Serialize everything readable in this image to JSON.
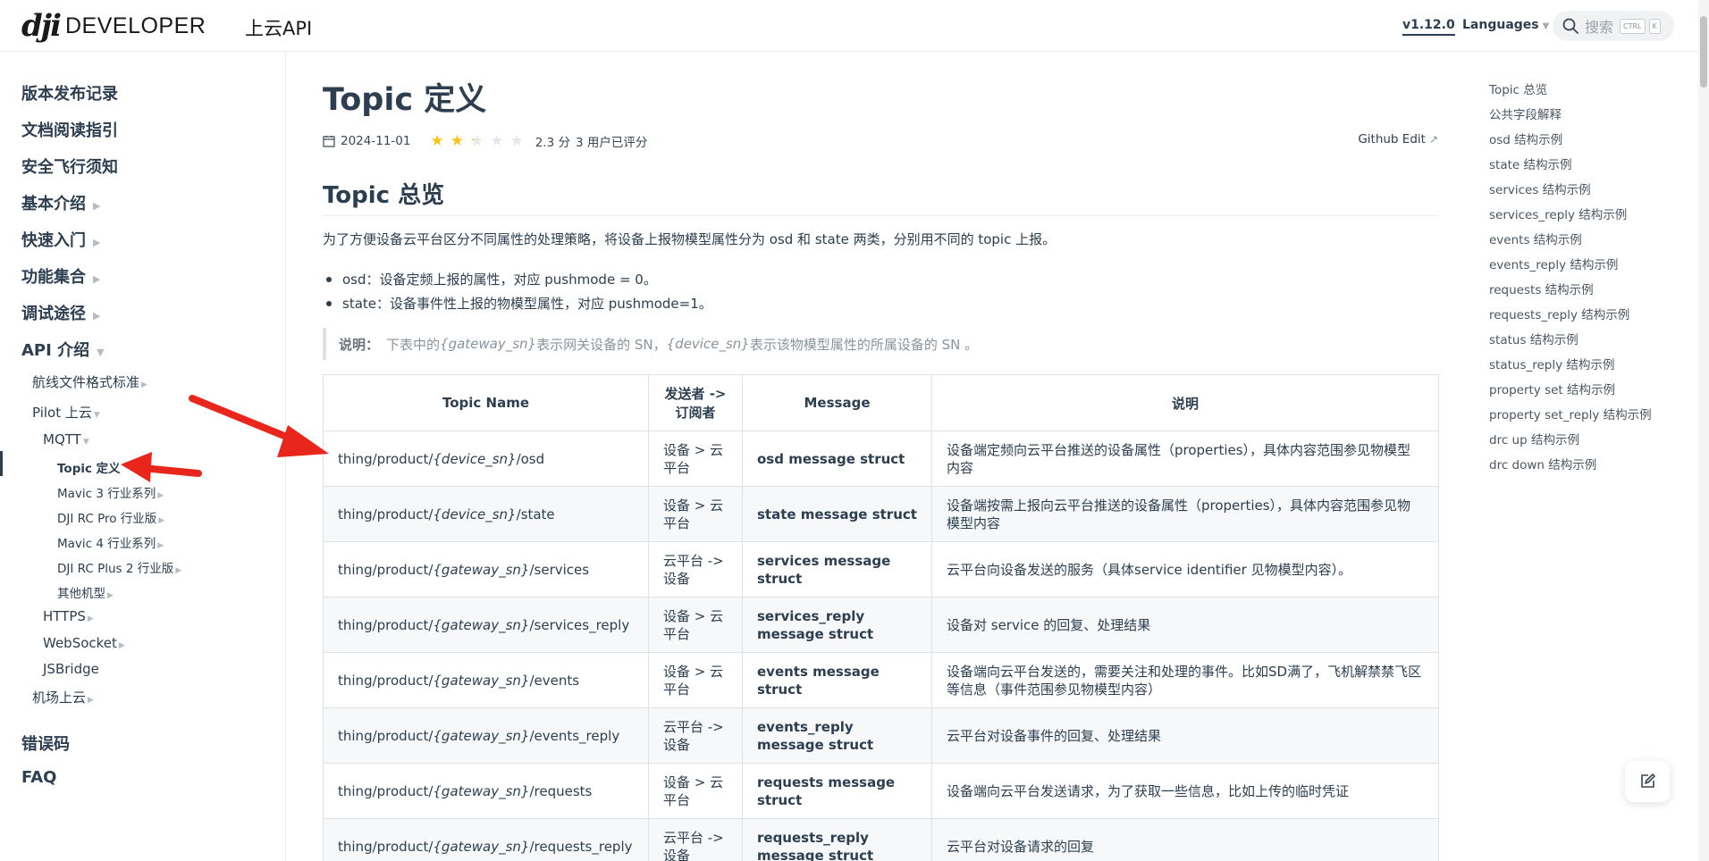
{
  "header": {
    "logo_mark": "dji",
    "logo_text": "DEVELOPER",
    "brand_sub": "上云API",
    "version": "v1.12.0",
    "languages": "Languages",
    "search_placeholder": "搜索",
    "kbd_ctrl": "CTRL",
    "kbd_k": "K"
  },
  "sidebar": {
    "top_items": [
      "版本发布记录",
      "文档阅读指引",
      "安全飞行须知",
      "基本介绍",
      "快速入门",
      "功能集合",
      "调试途径",
      "API 介绍",
      "错误码",
      "FAQ"
    ],
    "api_children": {
      "wayline": "航线文件格式标准",
      "pilot": "Pilot 上云",
      "mqtt": "MQTT",
      "topic": "Topic 定义",
      "mavic3": "Mavic 3 行业系列",
      "rcpro": "DJI RC Pro 行业版",
      "mavic4": "Mavic 4 行业系列",
      "rcplus2": "DJI RC Plus 2 行业版",
      "others": "其他机型",
      "https": "HTTPS",
      "websocket": "WebSocket",
      "jsbridge": "JSBridge",
      "dock": "机场上云"
    }
  },
  "page": {
    "title": "Topic 定义",
    "date": "2024-11-01",
    "rating": 2.3,
    "score_text": "2.3 分",
    "voters_text": "3 用户已评分",
    "github_edit": "Github Edit",
    "section_title": "Topic 总览",
    "intro": "为了方便设备云平台区分不同属性的处理策略，将设备上报物模型属性分为 osd 和 state 两类，分别用不同的 topic 上报。",
    "bullets": [
      "osd：设备定频上报的属性，对应 pushmode = 0。",
      "state：设备事件性上报的物模型属性，对应 pushmode=1。"
    ],
    "note": {
      "label": "说明：",
      "t1": "下表中的 ",
      "v1": "{gateway_sn}",
      "t2": " 表示网关设备的 SN，",
      "v2": "{device_sn}",
      "t3": " 表示该物模型属性的所属设备的 SN 。"
    }
  },
  "table": {
    "headers": [
      "Topic Name",
      "发送者 -> 订阅者",
      "Message",
      "说明"
    ],
    "rows": [
      {
        "pre": "thing/product/",
        "var": "{device_sn}",
        "post": "/osd",
        "dir": "设备 > 云平台",
        "msg": "osd message struct",
        "desc": "设备端定频向云平台推送的设备属性（properties），具体内容范围参见物模型内容"
      },
      {
        "pre": "thing/product/",
        "var": "{device_sn}",
        "post": "/state",
        "dir": "设备 > 云平台",
        "msg": "state message struct",
        "desc": "设备端按需上报向云平台推送的设备属性（properties），具体内容范围参见物模型内容"
      },
      {
        "pre": "thing/product/",
        "var": "{gateway_sn}",
        "post": "/services",
        "dir": "云平台 -> 设备",
        "msg": "services message struct",
        "desc": "云平台向设备发送的服务（具体service identifier 见物模型内容）。"
      },
      {
        "pre": "thing/product/",
        "var": "{gateway_sn}",
        "post": "/services_reply",
        "dir": "设备 > 云平台",
        "msg": "services_reply message struct",
        "desc": "设备对 service 的回复、处理结果"
      },
      {
        "pre": "thing/product/",
        "var": "{gateway_sn}",
        "post": "/events",
        "dir": "设备 > 云平台",
        "msg": "events message struct",
        "desc": "设备端向云平台发送的，需要关注和处理的事件。比如SD满了，飞机解禁禁飞区等信息（事件范围参见物模型内容）"
      },
      {
        "pre": "thing/product/",
        "var": "{gateway_sn}",
        "post": "/events_reply",
        "dir": "云平台 -> 设备",
        "msg": "events_reply message struct",
        "desc": "云平台对设备事件的回复、处理结果"
      },
      {
        "pre": "thing/product/",
        "var": "{gateway_sn}",
        "post": "/requests",
        "dir": "设备 > 云平台",
        "msg": "requests message struct",
        "desc": "设备端向云平台发送请求，为了获取一些信息，比如上传的临时凭证"
      },
      {
        "pre": "thing/product/",
        "var": "{gateway_sn}",
        "post": "/requests_reply",
        "dir": "云平台 -> 设备",
        "msg": "requests_reply message struct",
        "desc": "云平台对设备请求的回复"
      }
    ]
  },
  "toc": [
    "Topic 总览",
    "公共字段解释",
    "osd 结构示例",
    "state 结构示例",
    "services 结构示例",
    "services_reply 结构示例",
    "events 结构示例",
    "events_reply 结构示例",
    "requests 结构示例",
    "requests_reply 结构示例",
    "status 结构示例",
    "status_reply 结构示例",
    "property set 结构示例",
    "property set_reply 结构示例",
    "drc up 结构示例",
    "drc down 结构示例"
  ],
  "colors": {
    "star_on": "#f5c518",
    "star_off": "#e3e6ea",
    "annotation_arrow": "#e8261c",
    "text": "#2c3e50"
  },
  "icons": {
    "search": "search-icon",
    "calendar": "calendar-icon",
    "external": "external-link-icon",
    "edit": "edit-icon"
  }
}
